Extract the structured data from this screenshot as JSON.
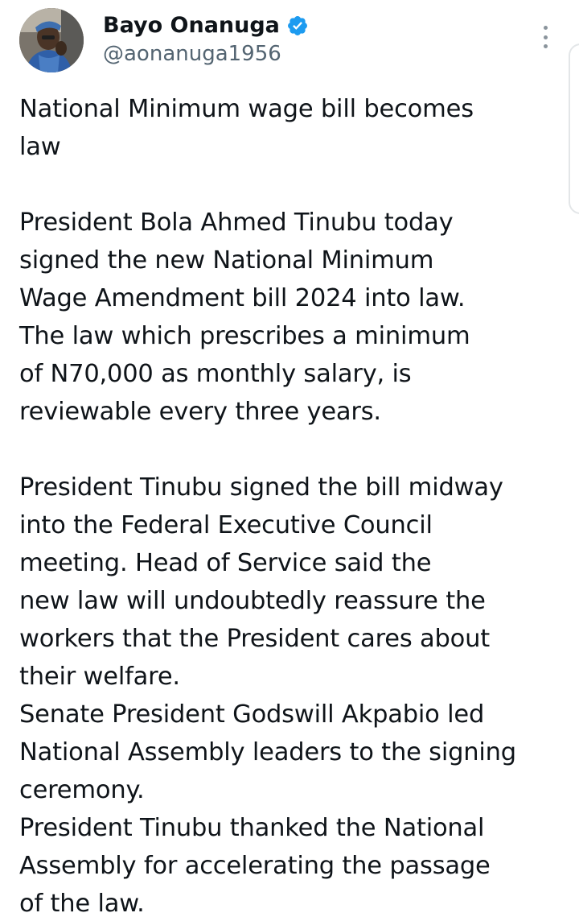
{
  "author": {
    "display_name": "Bayo Onanuga",
    "handle": "@aonanuga1956",
    "verified_icon": "verified-badge-icon",
    "avatar_icon": "profile-avatar",
    "verified_color": "#1d9bf0"
  },
  "menu": {
    "more_icon": "more-options-icon"
  },
  "tweet": {
    "paragraphs": [
      [
        "National Minimum wage bill becomes",
        "law"
      ],
      [
        "President Bola Ahmed Tinubu today",
        "signed the new National Minimum",
        "Wage Amendment bill 2024 into law.",
        "The law which prescribes a minimum",
        "of N70,000 as monthly salary, is",
        "reviewable every three years."
      ],
      [
        "President Tinubu signed the bill midway",
        "into the Federal Executive Council",
        "meeting. Head of Service said the",
        "new law will undoubtedly reassure the",
        "workers that the President cares about",
        "their welfare.",
        "Senate President Godswill Akpabio led",
        "National Assembly leaders to the signing",
        "ceremony.",
        "President Tinubu thanked the National",
        "Assembly for accelerating the passage",
        "of the law."
      ]
    ]
  },
  "colors": {
    "text": "#0f1419",
    "secondary_text": "#536471",
    "background": "#ffffff"
  }
}
